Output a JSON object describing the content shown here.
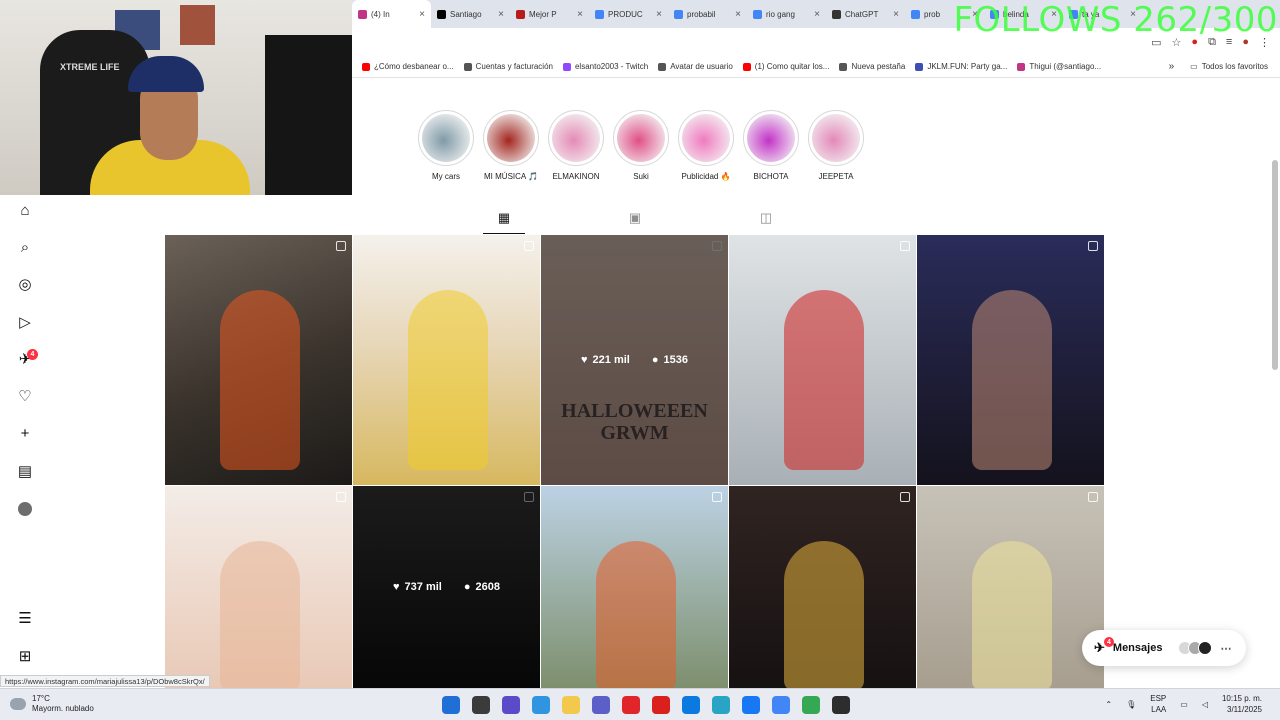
{
  "overlay": {
    "follows_text": "FOLLOWS 262/300"
  },
  "webcam": {
    "chair_text": "XTREME LIFE"
  },
  "tabs": [
    {
      "label": "(4) In",
      "color": "#c13584",
      "active": true
    },
    {
      "label": "Santiago",
      "color": "#000000"
    },
    {
      "label": "Mejor P",
      "color": "#b71c1c"
    },
    {
      "label": "PRODUC",
      "color": "#4285f4"
    },
    {
      "label": "probabil",
      "color": "#4285f4"
    },
    {
      "label": "rio gang",
      "color": "#4285f4"
    },
    {
      "label": "ChatGPT",
      "color": "#333333"
    },
    {
      "label": "prob",
      "color": "#4285f4"
    },
    {
      "label": "belinda",
      "color": "#4285f4"
    },
    {
      "label": "ta ya",
      "color": "#4285f4"
    }
  ],
  "bookmarks": [
    {
      "label": "¿Cómo desbanear o...",
      "color": "#ff0000"
    },
    {
      "label": "Cuentas y facturación",
      "color": "#555555"
    },
    {
      "label": "elsanto2003 - Twitch",
      "color": "#9146ff"
    },
    {
      "label": "Avatar de usuario",
      "color": "#555555"
    },
    {
      "label": "(1) Como quitar los...",
      "color": "#ff0000"
    },
    {
      "label": "Nueva pestaña",
      "color": "#555555"
    },
    {
      "label": "JKLM.FUN: Party ga...",
      "color": "#3d4fb5"
    },
    {
      "label": "Thigui (@santiago...",
      "color": "#c13584"
    }
  ],
  "bookmarks_favorites": "Todos los favoritos",
  "nav": {
    "badge_count": "4",
    "icons": [
      "home-icon",
      "search-icon",
      "explore-icon",
      "reels-icon",
      "messages-icon",
      "notifications-icon",
      "create-icon",
      "dashboard-icon",
      "profile-avatar"
    ],
    "more_icon": "menu-icon",
    "meta_icon": "apps-icon"
  },
  "highlights": [
    {
      "label": "My cars",
      "color": "#7f9aa7"
    },
    {
      "label": "MI MÚSICA 🎵",
      "color": "#a3261f"
    },
    {
      "label": "ELMAKINON",
      "color": "#e48ab5"
    },
    {
      "label": "Suki",
      "color": "#e04f86"
    },
    {
      "label": "Publicidad 🔥",
      "color": "#f07bc0"
    },
    {
      "label": "BICHOTA",
      "color": "#c233c7"
    },
    {
      "label": "JEEPETA",
      "color": "#e389b9"
    }
  ],
  "profile_tabs": [
    "grid-icon",
    "reels-tab-icon",
    "tagged-icon"
  ],
  "posts": [
    {
      "bg": "linear-gradient(160deg,#6b6158,#3a332c 55%,#1c1a18)",
      "accent": "#e7581f"
    },
    {
      "bg": "linear-gradient(180deg,#f4f1ec,#e7d6b7 45%,#d7b85f)",
      "accent": "#f0cc28"
    },
    {
      "bg": "linear-gradient(180deg,#e9d2c2,#cfa69a)",
      "hover": true,
      "likes": "221 mil",
      "comments": "1536",
      "text": "HALLOWEEEN GRWM"
    },
    {
      "bg": "linear-gradient(180deg,#dfe3e6,#a9b0b5)",
      "accent": "#d21f1f"
    },
    {
      "bg": "linear-gradient(180deg,#2a2c5a,#14121c)",
      "accent": "#c08a74"
    },
    {
      "bg": "linear-gradient(180deg,#f3ece7,#e9c9b6)",
      "accent": "#e8b496"
    },
    {
      "bg": "linear-gradient(180deg,#3d3d3d,#101010)",
      "hover": true,
      "likes": "737 mil",
      "comments": "2608"
    },
    {
      "bg": "linear-gradient(180deg,#bcd2e4,#7d8f6d)",
      "accent": "#e85b26"
    },
    {
      "bg": "linear-gradient(180deg,#302421,#161112)",
      "accent": "#e6b23c"
    },
    {
      "bg": "linear-gradient(180deg,#c7c2b8,#a79e8f)",
      "accent": "#efe39a"
    }
  ],
  "status_url": "https://www.instagram.com/mariajulissa13/p/DObw8cSkrQx/",
  "messages": {
    "label": "Mensajes",
    "badge": "4"
  },
  "taskbar": {
    "temp": "17°C",
    "weather": "Mayorm. nublado",
    "lang1": "ESP",
    "lang2": "LAA",
    "time": "10:15 p. m.",
    "date": "3/11/2025",
    "apps": [
      "#1f6fd6",
      "#3b3b3b",
      "#5a4cc9",
      "#2f95e0",
      "#f2c94c",
      "#5b5fc7",
      "#e0262a",
      "#d9201c",
      "#0a7ae0",
      "#2aa4c4",
      "#1877f2",
      "#4285f4",
      "#34a853",
      "#2d2d2d"
    ]
  }
}
